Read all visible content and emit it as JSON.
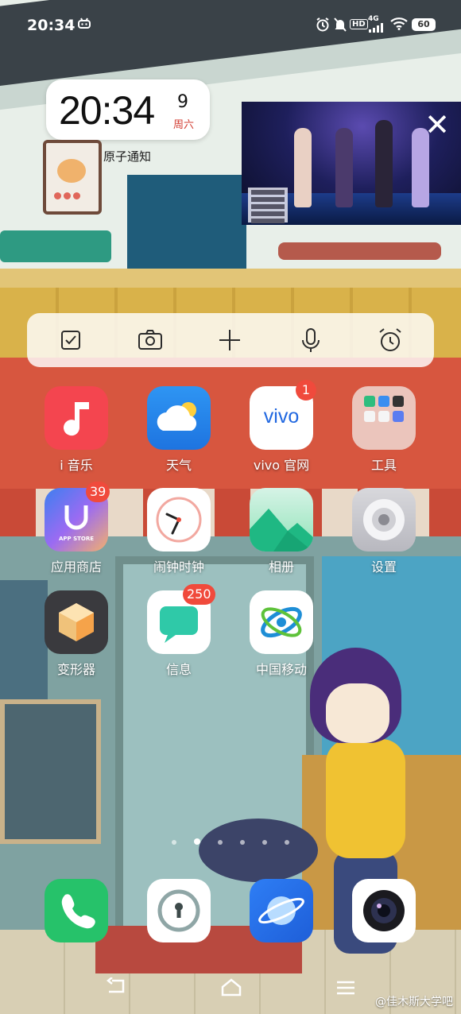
{
  "status_bar": {
    "time": "20:34",
    "battery": "60",
    "hd_label": "HD",
    "network_label": "4G"
  },
  "clock_widget": {
    "time": "20:34",
    "day": "9",
    "weekday": "周六"
  },
  "notification_widget": {
    "label": "原子通知"
  },
  "video_widget": {
    "close_icon": "close-icon"
  },
  "quick_bar": {
    "items": [
      "checkbox-icon",
      "camera-icon",
      "add-icon",
      "microphone-icon",
      "alarm-icon"
    ]
  },
  "apps": {
    "imusic": {
      "label": "i 音乐"
    },
    "weather": {
      "label": "天气"
    },
    "vivo": {
      "label": "vivo 官网",
      "badge": "1",
      "logo_text": "vivo"
    },
    "tools": {
      "label": "工具"
    },
    "appstore": {
      "label": "应用商店",
      "badge": "39",
      "icon_text": "APP STORE"
    },
    "clock": {
      "label": "闹钟时钟"
    },
    "gallery": {
      "label": "相册"
    },
    "settings": {
      "label": "设置"
    },
    "transformer": {
      "label": "变形器"
    },
    "messages": {
      "label": "信息",
      "badge": "250"
    },
    "chinamobile": {
      "label": "中国移动"
    }
  },
  "page_indicator": {
    "count": 7,
    "active_index": 1
  },
  "watermark": "@佳木斯大学吧",
  "colors": {
    "badge": "#f04a3c",
    "weekday": "#d23b30"
  }
}
